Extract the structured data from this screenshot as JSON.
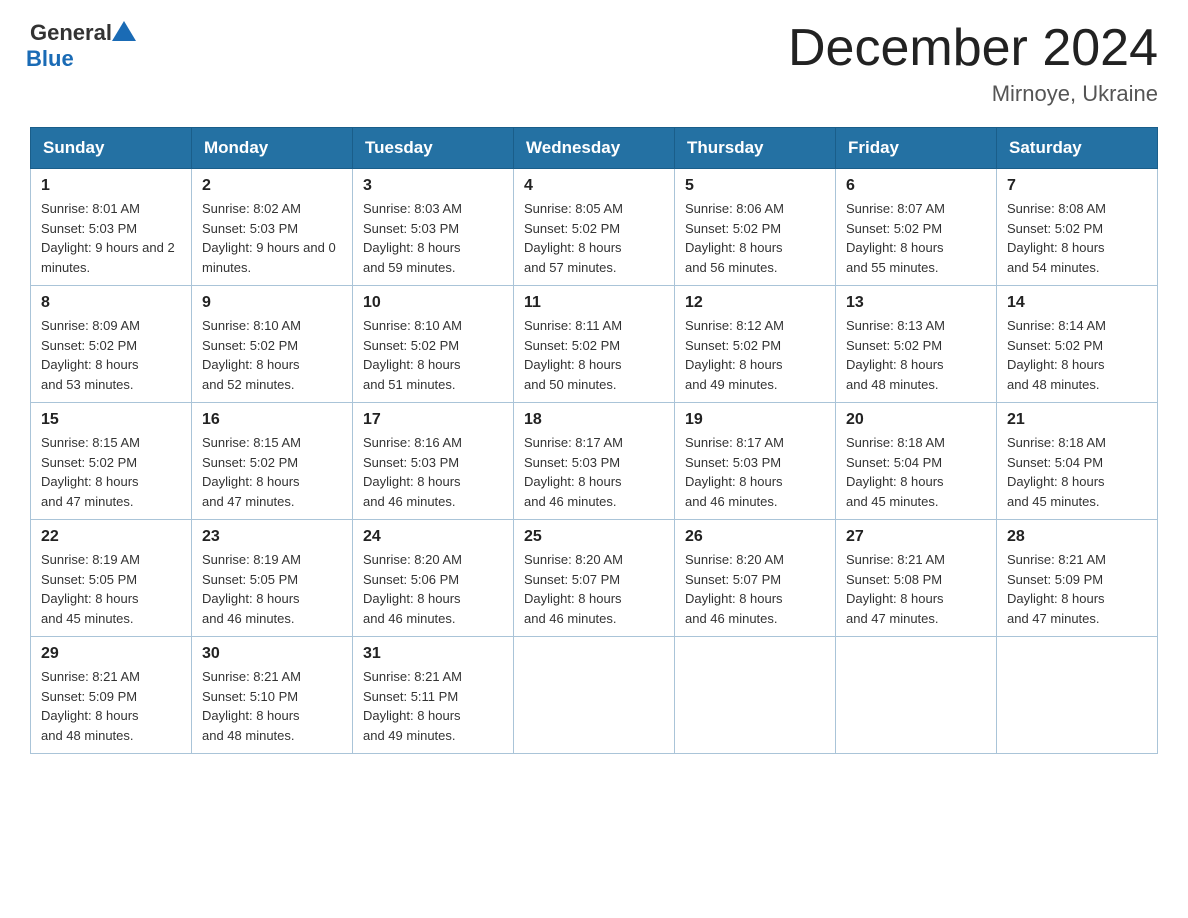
{
  "logo": {
    "general": "General",
    "blue": "Blue"
  },
  "title": "December 2024",
  "subtitle": "Mirnoye, Ukraine",
  "weekdays": [
    "Sunday",
    "Monday",
    "Tuesday",
    "Wednesday",
    "Thursday",
    "Friday",
    "Saturday"
  ],
  "weeks": [
    [
      {
        "day": "1",
        "sunrise": "8:01 AM",
        "sunset": "5:03 PM",
        "daylight": "9 hours and 2 minutes."
      },
      {
        "day": "2",
        "sunrise": "8:02 AM",
        "sunset": "5:03 PM",
        "daylight": "9 hours and 0 minutes."
      },
      {
        "day": "3",
        "sunrise": "8:03 AM",
        "sunset": "5:03 PM",
        "daylight": "8 hours and 59 minutes."
      },
      {
        "day": "4",
        "sunrise": "8:05 AM",
        "sunset": "5:02 PM",
        "daylight": "8 hours and 57 minutes."
      },
      {
        "day": "5",
        "sunrise": "8:06 AM",
        "sunset": "5:02 PM",
        "daylight": "8 hours and 56 minutes."
      },
      {
        "day": "6",
        "sunrise": "8:07 AM",
        "sunset": "5:02 PM",
        "daylight": "8 hours and 55 minutes."
      },
      {
        "day": "7",
        "sunrise": "8:08 AM",
        "sunset": "5:02 PM",
        "daylight": "8 hours and 54 minutes."
      }
    ],
    [
      {
        "day": "8",
        "sunrise": "8:09 AM",
        "sunset": "5:02 PM",
        "daylight": "8 hours and 53 minutes."
      },
      {
        "day": "9",
        "sunrise": "8:10 AM",
        "sunset": "5:02 PM",
        "daylight": "8 hours and 52 minutes."
      },
      {
        "day": "10",
        "sunrise": "8:10 AM",
        "sunset": "5:02 PM",
        "daylight": "8 hours and 51 minutes."
      },
      {
        "day": "11",
        "sunrise": "8:11 AM",
        "sunset": "5:02 PM",
        "daylight": "8 hours and 50 minutes."
      },
      {
        "day": "12",
        "sunrise": "8:12 AM",
        "sunset": "5:02 PM",
        "daylight": "8 hours and 49 minutes."
      },
      {
        "day": "13",
        "sunrise": "8:13 AM",
        "sunset": "5:02 PM",
        "daylight": "8 hours and 48 minutes."
      },
      {
        "day": "14",
        "sunrise": "8:14 AM",
        "sunset": "5:02 PM",
        "daylight": "8 hours and 48 minutes."
      }
    ],
    [
      {
        "day": "15",
        "sunrise": "8:15 AM",
        "sunset": "5:02 PM",
        "daylight": "8 hours and 47 minutes."
      },
      {
        "day": "16",
        "sunrise": "8:15 AM",
        "sunset": "5:02 PM",
        "daylight": "8 hours and 47 minutes."
      },
      {
        "day": "17",
        "sunrise": "8:16 AM",
        "sunset": "5:03 PM",
        "daylight": "8 hours and 46 minutes."
      },
      {
        "day": "18",
        "sunrise": "8:17 AM",
        "sunset": "5:03 PM",
        "daylight": "8 hours and 46 minutes."
      },
      {
        "day": "19",
        "sunrise": "8:17 AM",
        "sunset": "5:03 PM",
        "daylight": "8 hours and 46 minutes."
      },
      {
        "day": "20",
        "sunrise": "8:18 AM",
        "sunset": "5:04 PM",
        "daylight": "8 hours and 45 minutes."
      },
      {
        "day": "21",
        "sunrise": "8:18 AM",
        "sunset": "5:04 PM",
        "daylight": "8 hours and 45 minutes."
      }
    ],
    [
      {
        "day": "22",
        "sunrise": "8:19 AM",
        "sunset": "5:05 PM",
        "daylight": "8 hours and 45 minutes."
      },
      {
        "day": "23",
        "sunrise": "8:19 AM",
        "sunset": "5:05 PM",
        "daylight": "8 hours and 46 minutes."
      },
      {
        "day": "24",
        "sunrise": "8:20 AM",
        "sunset": "5:06 PM",
        "daylight": "8 hours and 46 minutes."
      },
      {
        "day": "25",
        "sunrise": "8:20 AM",
        "sunset": "5:07 PM",
        "daylight": "8 hours and 46 minutes."
      },
      {
        "day": "26",
        "sunrise": "8:20 AM",
        "sunset": "5:07 PM",
        "daylight": "8 hours and 46 minutes."
      },
      {
        "day": "27",
        "sunrise": "8:21 AM",
        "sunset": "5:08 PM",
        "daylight": "8 hours and 47 minutes."
      },
      {
        "day": "28",
        "sunrise": "8:21 AM",
        "sunset": "5:09 PM",
        "daylight": "8 hours and 47 minutes."
      }
    ],
    [
      {
        "day": "29",
        "sunrise": "8:21 AM",
        "sunset": "5:09 PM",
        "daylight": "8 hours and 48 minutes."
      },
      {
        "day": "30",
        "sunrise": "8:21 AM",
        "sunset": "5:10 PM",
        "daylight": "8 hours and 48 minutes."
      },
      {
        "day": "31",
        "sunrise": "8:21 AM",
        "sunset": "5:11 PM",
        "daylight": "8 hours and 49 minutes."
      },
      null,
      null,
      null,
      null
    ]
  ]
}
